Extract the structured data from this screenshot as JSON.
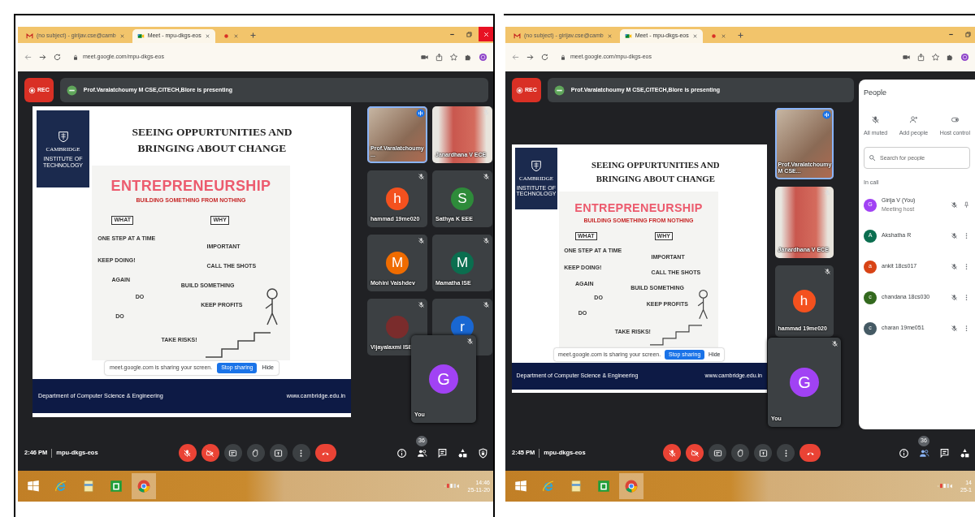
{
  "screens": [
    {
      "browser": {
        "tabs": [
          {
            "kind": "mail",
            "title": "(no subject) - girijav.cse@camb",
            "selected": false
          },
          {
            "kind": "meet",
            "title": "Meet - mpu-dkgs-eos",
            "selected": true
          },
          {
            "kind": "recording",
            "selected": false
          }
        ],
        "window_controls": [
          {
            "kind": "minimize"
          },
          {
            "kind": "restore"
          },
          {
            "kind": "close"
          }
        ],
        "url": "meet.google.com/mpu-dkgs-eos",
        "toolbar_icons": [
          {
            "kind": "camera"
          },
          {
            "kind": "share"
          },
          {
            "kind": "star"
          },
          {
            "kind": "extensions"
          },
          {
            "kind": "profile"
          }
        ]
      },
      "meet": {
        "rec_label": "REC",
        "banner": "Prof.Varalatchoumy M CSE,CITECH,Blore is presenting",
        "slide": {
          "logo_name": "CAMBRIDGE",
          "logo_sub": "INSTITUTE OF TECHNOLOGY",
          "title_lines": [
            "SEEING OPPURTUNITIES AND",
            "BRINGING ABOUT CHANGE"
          ],
          "sketch_title": "ENTREPRENEURSHIP",
          "sketch_subtitle": "BUILDING SOMETHING FROM NOTHING",
          "sketch_labels": [
            "WHAT",
            "WHY",
            "ONE STEP AT A TIME",
            "KEEP DOING!",
            "AGAIN",
            "DO",
            "DO",
            "TAKE RISKS!",
            "IMPORTANT",
            "CALL THE SHOTS",
            "BUILD SOMETHING",
            "KEEP PROFITS"
          ],
          "footer_left": "Department of Computer Science & Engineering",
          "footer_right": "www.cambridge.edu.in",
          "share_notice": "meet.google.com is sharing your screen.",
          "share_stop": "Stop sharing",
          "share_hide": "Hide"
        },
        "tiles": [
          {
            "kind": "video",
            "name": "Prof.Varalatchoumy ...",
            "speaking": true
          },
          {
            "kind": "video",
            "name": "Janardhana V ECE",
            "speaking": false
          },
          {
            "kind": "avatar",
            "name": "hammad 19me020",
            "initial": "h",
            "color": "#f4511e",
            "speaking": false
          },
          {
            "kind": "avatar",
            "name": "Sathya K EEE",
            "initial": "S",
            "color": "#2e8b3a",
            "speaking": false
          },
          {
            "kind": "avatar",
            "name": "Mohini Vaishdev",
            "initial": "M",
            "color": "#ef6c00",
            "speaking": false
          },
          {
            "kind": "avatar",
            "name": "Mamatha ISE",
            "initial": "M",
            "color": "#0b6e4f",
            "speaking": false
          },
          {
            "kind": "photo",
            "name": "Vijayalaxmi ISE",
            "speaking": false
          },
          {
            "kind": "avatar",
            "initial": "r",
            "color": "#1967d2",
            "speaking": false
          }
        ],
        "self_tile": {
          "name": "You",
          "initial": "G",
          "color": "#a142f4"
        },
        "time": "2:46 PM",
        "code": "mpu-dkgs-eos",
        "controls": [
          {
            "kind": "mic",
            "on": false
          },
          {
            "kind": "camera",
            "on": false
          },
          {
            "kind": "captions"
          },
          {
            "kind": "hand"
          },
          {
            "kind": "present"
          },
          {
            "kind": "more"
          },
          {
            "kind": "end"
          }
        ],
        "side_icons": [
          {
            "kind": "info",
            "selected": false
          },
          {
            "kind": "people",
            "selected": false,
            "badge": "36"
          },
          {
            "kind": "chat",
            "selected": false
          },
          {
            "kind": "activities",
            "selected": false
          },
          {
            "kind": "safety",
            "selected": false
          }
        ]
      },
      "taskbar": {
        "apps": [
          {
            "kind": "start",
            "selected": false
          },
          {
            "kind": "ie",
            "selected": false
          },
          {
            "kind": "explorer",
            "selected": false
          },
          {
            "kind": "store",
            "selected": false
          },
          {
            "kind": "chrome",
            "selected": true
          }
        ],
        "clock_time": "14:46",
        "clock_date": "25-11-20"
      }
    },
    {
      "browser": {
        "tabs": [
          {
            "kind": "mail",
            "title": "(no subject) - girijav.cse@camb",
            "selected": false
          },
          {
            "kind": "meet",
            "title": "Meet - mpu-dkgs-eos",
            "selected": true
          },
          {
            "kind": "recording",
            "selected": false
          }
        ],
        "window_controls": [
          {
            "kind": "minimize"
          },
          {
            "kind": "restore"
          }
        ],
        "url": "meet.google.com/mpu-dkgs-eos",
        "toolbar_icons": [
          {
            "kind": "camera"
          },
          {
            "kind": "share"
          },
          {
            "kind": "star"
          },
          {
            "kind": "extensions"
          },
          {
            "kind": "profile"
          }
        ]
      },
      "meet": {
        "rec_label": "REC",
        "banner": "Prof.Varalatchoumy M CSE,CITECH,Blore is presenting",
        "slide": {
          "logo_name": "CAMBRIDGE",
          "logo_sub": "INSTITUTE OF TECHNOLOGY",
          "title_lines": [
            "SEEING OPPURTUNITIES AND",
            "BRINGING ABOUT CHANGE"
          ],
          "sketch_title": "ENTREPRENEURSHIP",
          "sketch_subtitle": "BUILDING SOMETHING FROM NOTHING",
          "sketch_labels": [
            "WHAT",
            "WHY",
            "ONE STEP AT A TIME",
            "KEEP DOING!",
            "AGAIN",
            "DO",
            "DO",
            "TAKE RISKS!",
            "IMPORTANT",
            "CALL THE SHOTS",
            "BUILD SOMETHING",
            "KEEP PROFITS"
          ],
          "footer_left": "Department of Computer Science & Engineering",
          "footer_right": "www.cambridge.edu.in",
          "share_notice": "meet.google.com is sharing your screen.",
          "share_stop": "Stop sharing",
          "share_hide": "Hide"
        },
        "tiles": [
          {
            "kind": "video",
            "name": "Prof.Varalatchoumy M CSE...",
            "speaking": true
          },
          {
            "kind": "video",
            "name": "Janardhana V ECE",
            "speaking": false
          },
          {
            "kind": "avatar",
            "name": "hammad 19me020",
            "initial": "h",
            "color": "#f4511e",
            "speaking": false
          }
        ],
        "self_tile": {
          "name": "You",
          "initial": "G",
          "color": "#a142f4"
        },
        "time": "2:45 PM",
        "code": "mpu-dkgs-eos",
        "controls": [
          {
            "kind": "mic",
            "on": false
          },
          {
            "kind": "camera",
            "on": false
          },
          {
            "kind": "captions"
          },
          {
            "kind": "hand"
          },
          {
            "kind": "present"
          },
          {
            "kind": "more"
          },
          {
            "kind": "end"
          }
        ],
        "side_icons": [
          {
            "kind": "info",
            "selected": false
          },
          {
            "kind": "people",
            "selected": true,
            "badge": "36"
          },
          {
            "kind": "chat",
            "selected": false
          },
          {
            "kind": "activities",
            "selected": false
          }
        ],
        "people_panel": {
          "title": "People",
          "actions": [
            {
              "kind": "mute",
              "label": "All muted"
            },
            {
              "kind": "add",
              "label": "Add people"
            },
            {
              "kind": "host",
              "label": "Host control"
            }
          ],
          "search_placeholder": "Search for people",
          "section": "In call",
          "people": [
            {
              "kind": "host",
              "name": "Girija V (You)",
              "role": "Meeting host",
              "initial": "G",
              "color": "#a142f4"
            },
            {
              "kind": "guest",
              "name": "Akshatha R",
              "initial": "A",
              "color": "#0b6e4f"
            },
            {
              "kind": "guest",
              "name": "ankit 18cs017",
              "initial": "a",
              "color": "#d84315"
            },
            {
              "kind": "guest",
              "name": "chandana 18cs030",
              "initial": "c",
              "color": "#33691e"
            },
            {
              "kind": "guest",
              "name": "charan 19me051",
              "initial": "c",
              "color": "#455a64"
            }
          ]
        }
      },
      "taskbar": {
        "apps": [
          {
            "kind": "start",
            "selected": false
          },
          {
            "kind": "ie",
            "selected": false
          },
          {
            "kind": "explorer",
            "selected": false
          },
          {
            "kind": "store",
            "selected": false
          },
          {
            "kind": "chrome",
            "selected": true
          }
        ],
        "clock_time": "14",
        "clock_date": "25-1"
      }
    }
  ]
}
